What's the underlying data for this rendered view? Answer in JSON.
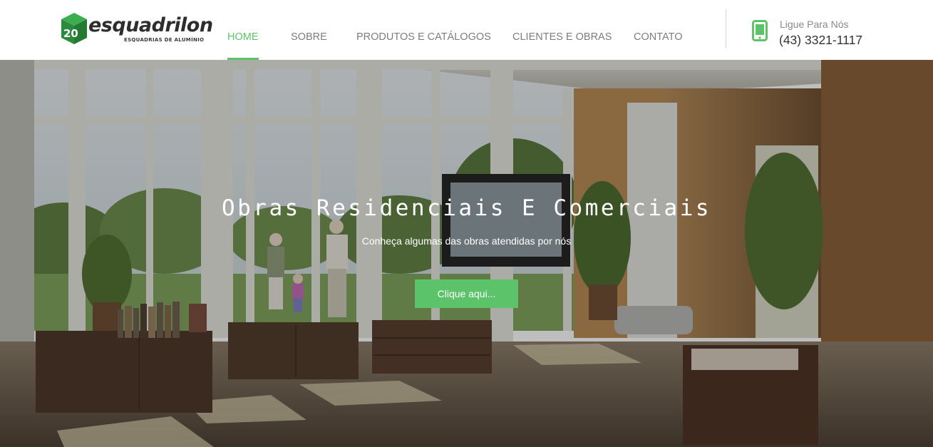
{
  "brand": {
    "name": "esquadrilon",
    "tagline": "ESQUADRIAS DE ALUMÍNIO",
    "logo_mark": "20",
    "logo_color": "#2f9e44"
  },
  "nav": {
    "items": [
      {
        "label": "HOME",
        "active": true
      },
      {
        "label": "SOBRE",
        "active": false
      },
      {
        "label": "PRODUTOS E CATÁLOGOS",
        "active": false
      },
      {
        "label": "CLIENTES E OBRAS",
        "active": false
      },
      {
        "label": "CONTATO",
        "active": false
      }
    ],
    "accent_color": "#5cc36a"
  },
  "contact": {
    "icon": "smartphone-icon",
    "label": "Ligue Para Nós",
    "phone": "(43) 3321-1117"
  },
  "hero": {
    "title": "Obras Residenciais E Comerciais",
    "subtitle": "Conheça algumas das obras atendidas por nós",
    "button_label": "Clique aqui...",
    "button_color": "#5cc36a"
  }
}
